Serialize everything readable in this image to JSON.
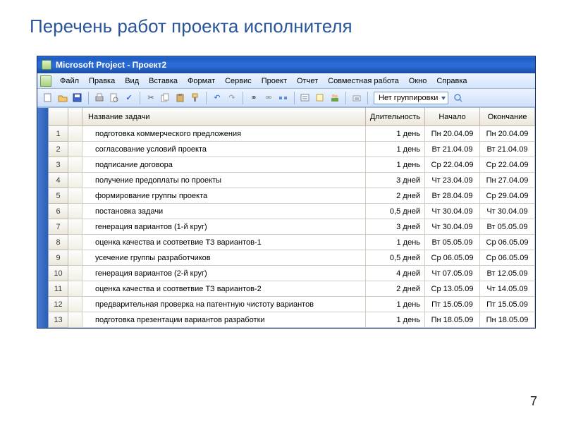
{
  "slide": {
    "title": "Перечень работ проекта исполнителя",
    "page_number": "7"
  },
  "window": {
    "title": "Microsoft Project - Проект2"
  },
  "menu": {
    "items": [
      "Файл",
      "Правка",
      "Вид",
      "Вставка",
      "Формат",
      "Сервис",
      "Проект",
      "Отчет",
      "Совместная работа",
      "Окно",
      "Справка"
    ]
  },
  "toolbar": {
    "grouping_value": "Нет группировки"
  },
  "table": {
    "headers": {
      "name": "Название задачи",
      "duration": "Длительность",
      "start": "Начало",
      "end": "Окончание"
    },
    "rows": [
      {
        "id": "1",
        "name": "подготовка коммерческого предложения",
        "dur": "1 день",
        "start": "Пн 20.04.09",
        "end": "Пн 20.04.09"
      },
      {
        "id": "2",
        "name": "согласование условий проекта",
        "dur": "1 день",
        "start": "Вт 21.04.09",
        "end": "Вт 21.04.09"
      },
      {
        "id": "3",
        "name": "подписание договора",
        "dur": "1 день",
        "start": "Ср 22.04.09",
        "end": "Ср 22.04.09"
      },
      {
        "id": "4",
        "name": "получение предоплаты по проекты",
        "dur": "3 дней",
        "start": "Чт 23.04.09",
        "end": "Пн 27.04.09"
      },
      {
        "id": "5",
        "name": "формирование группы проекта",
        "dur": "2 дней",
        "start": "Вт 28.04.09",
        "end": "Ср 29.04.09"
      },
      {
        "id": "6",
        "name": "постановка задачи",
        "dur": "0,5 дней",
        "start": "Чт 30.04.09",
        "end": "Чт 30.04.09"
      },
      {
        "id": "7",
        "name": "генерация вариантов (1-й круг)",
        "dur": "3 дней",
        "start": "Чт 30.04.09",
        "end": "Вт 05.05.09"
      },
      {
        "id": "8",
        "name": "оценка качества и соответвие ТЗ вариантов-1",
        "dur": "1 день",
        "start": "Вт 05.05.09",
        "end": "Ср 06.05.09"
      },
      {
        "id": "9",
        "name": "усечение группы разработчиков",
        "dur": "0,5 дней",
        "start": "Ср 06.05.09",
        "end": "Ср 06.05.09"
      },
      {
        "id": "10",
        "name": "генерация вариантов (2-й круг)",
        "dur": "4 дней",
        "start": "Чт 07.05.09",
        "end": "Вт 12.05.09"
      },
      {
        "id": "11",
        "name": "оценка качества и соответвие ТЗ вариантов-2",
        "dur": "2 дней",
        "start": "Ср 13.05.09",
        "end": "Чт 14.05.09"
      },
      {
        "id": "12",
        "name": "предварительная проверка на патентную чистоту вариантов",
        "dur": "1 день",
        "start": "Пт 15.05.09",
        "end": "Пт 15.05.09"
      },
      {
        "id": "13",
        "name": "подготовка презентации вариантов разработки",
        "dur": "1 день",
        "start": "Пн 18.05.09",
        "end": "Пн 18.05.09"
      }
    ]
  }
}
